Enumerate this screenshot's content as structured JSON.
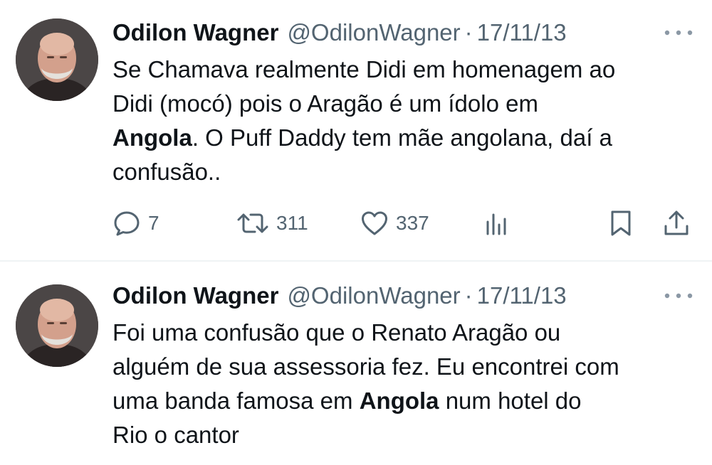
{
  "tweets": [
    {
      "author_name": "Odilon Wagner",
      "handle": "@OdilonWagner",
      "separator": "·",
      "date": "17/11/13",
      "text": {
        "line1": "Se Chamava realmente Didi em homenagem ao",
        "line2": "Didi (mocó) pois  o Aragão é um ídolo em",
        "line3_bold": "Angola",
        "line3_rest": ".  O Puff Daddy tem mãe angolana, daí a",
        "line4": "confusão.."
      },
      "actions": {
        "replies": "7",
        "retweets": "311",
        "likes": "337"
      }
    },
    {
      "author_name": "Odilon Wagner",
      "handle": "@OdilonWagner",
      "separator": "·",
      "date": "17/11/13",
      "text": {
        "line1": "Foi uma confusão que o Renato Aragão ou",
        "line2": "alguém de sua assessoria fez. Eu encontrei com",
        "line3_pre": "uma banda famosa em ",
        "line3_bold": "Angola",
        "line3_rest": " num hotel do",
        "line4": "Rio o cantor"
      }
    }
  ],
  "icons": {
    "reply": "reply-icon",
    "retweet": "retweet-icon",
    "like": "heart-icon",
    "views": "views-icon",
    "bookmark": "bookmark-icon",
    "share": "share-icon",
    "more": "more-icon"
  },
  "colors": {
    "text": "#0f1419",
    "secondary": "#536471",
    "divider": "#eff3f4"
  }
}
